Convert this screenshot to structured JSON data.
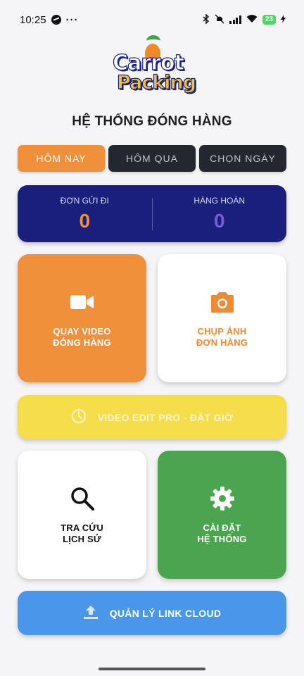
{
  "status_bar": {
    "time": "10:25",
    "dots": "···",
    "battery": "23"
  },
  "logo": {
    "line1": "Carrot",
    "line2": "Packing"
  },
  "page_title": "HỆ THỐNG ĐÓNG HÀNG",
  "tabs": [
    {
      "label": "HÔM NAY",
      "active": true
    },
    {
      "label": "HÔM QUA",
      "active": false
    },
    {
      "label": "CHỌN NGÀY",
      "active": false
    }
  ],
  "stats": {
    "sent_label": "ĐƠN GỬI ĐI",
    "sent_value": "0",
    "sent_color": "#f0903a",
    "returned_label": "HÀNG HOÀN",
    "returned_value": "0",
    "returned_color": "#7c5bd6"
  },
  "tiles": {
    "video": {
      "line1": "QUAY VIDEO",
      "line2": "ĐÓNG HÀNG",
      "icon": "videocam-icon"
    },
    "photo": {
      "line1": "CHỤP ẢNH",
      "line2": "ĐƠN HÀNG",
      "icon": "camera-icon"
    },
    "search": {
      "line1": "TRA CỨU",
      "line2": "LỊCH SỬ",
      "icon": "search-icon"
    },
    "settings": {
      "line1": "CÀI ĐẶT",
      "line2": "HỆ THỐNG",
      "icon": "gear-icon"
    }
  },
  "buttons": {
    "video_edit_pro": {
      "label": "VIDEO EDIT PRO - ĐẶT GIỜ",
      "icon": "clock-icon"
    },
    "cloud": {
      "label": "QUẢN LÝ LINK CLOUD",
      "icon": "upload-icon"
    }
  },
  "colors": {
    "accent_orange": "#f0903a",
    "navy": "#1b1f7c",
    "yellow": "#f6dd4a",
    "green": "#4ba54f",
    "blue": "#4a96ea",
    "dark_tab": "#23272f"
  }
}
